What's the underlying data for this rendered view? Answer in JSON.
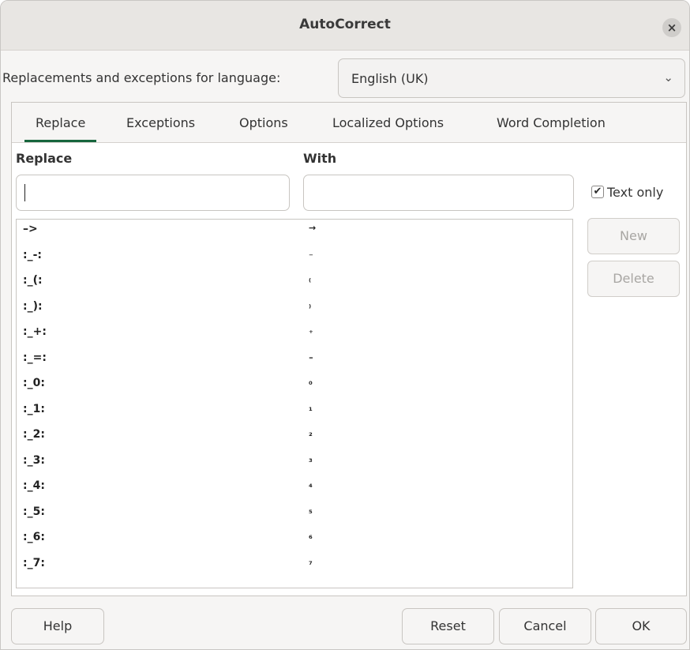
{
  "window": {
    "title": "AutoCorrect",
    "close_glyph": "×"
  },
  "language": {
    "label": "Replacements and exceptions for language:",
    "selected": "English (UK)",
    "chevron_glyph": "⌄"
  },
  "tabs": [
    {
      "label": "Replace",
      "active": true
    },
    {
      "label": "Exceptions",
      "active": false
    },
    {
      "label": "Options",
      "active": false
    },
    {
      "label": "Localized Options",
      "active": false
    },
    {
      "label": "Word Completion",
      "active": false
    }
  ],
  "replace_panel": {
    "replace_header": "Replace",
    "with_header": "With",
    "replace_value": "",
    "with_value": "",
    "text_only_label": "Text only",
    "text_only_checked": true,
    "checkmark_glyph": "✔",
    "new_label": "New",
    "delete_label": "Delete"
  },
  "entries": [
    {
      "replace": "–>",
      "with": "→"
    },
    {
      "replace": ":_-:",
      "with": "₋"
    },
    {
      "replace": ":_(:",
      "with": "₍"
    },
    {
      "replace": ":_):",
      "with": "₎"
    },
    {
      "replace": ":_+:",
      "with": "₊"
    },
    {
      "replace": ":_=:",
      "with": "₌"
    },
    {
      "replace": ":_0:",
      "with": "₀"
    },
    {
      "replace": ":_1:",
      "with": "₁"
    },
    {
      "replace": ":_2:",
      "with": "₂"
    },
    {
      "replace": ":_3:",
      "with": "₃"
    },
    {
      "replace": ":_4:",
      "with": "₄"
    },
    {
      "replace": ":_5:",
      "with": "₅"
    },
    {
      "replace": ":_6:",
      "with": "₆"
    },
    {
      "replace": ":_7:",
      "with": "₇"
    }
  ],
  "footer": {
    "help": "Help",
    "reset": "Reset",
    "cancel": "Cancel",
    "ok": "OK"
  },
  "colors": {
    "active_tab_underline": "#17653d",
    "disabled_text": "#a8a6a3"
  }
}
